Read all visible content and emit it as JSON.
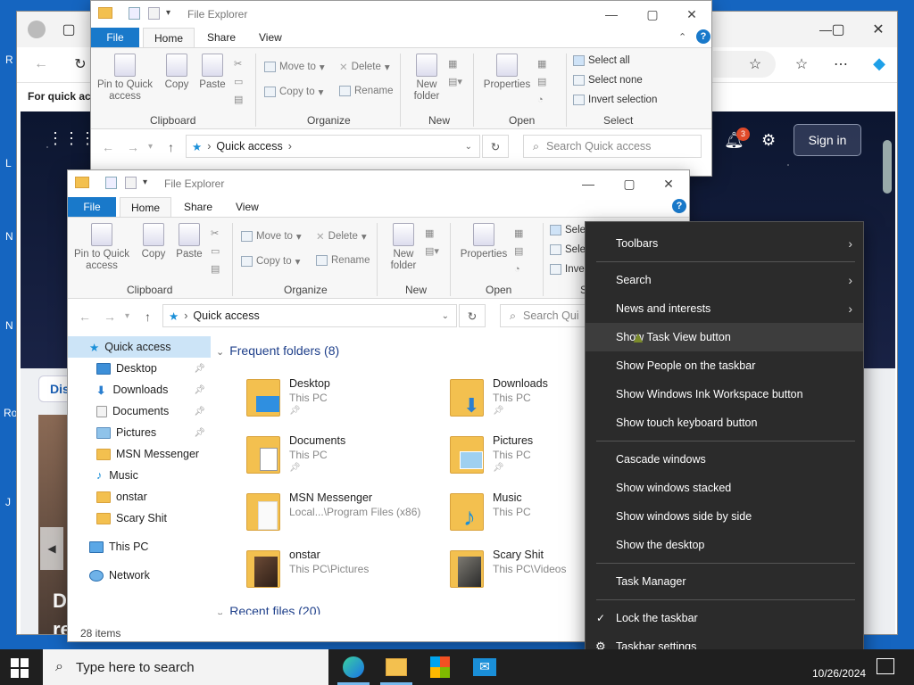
{
  "browser": {
    "address_partial": "For quick acc",
    "sign_in": "Sign in",
    "badge": "3",
    "card_label": "Dis",
    "card_big1": "D",
    "card_big2": "re",
    "card_row_label": "Ro"
  },
  "explorer_back": {
    "title": "File Explorer",
    "tabs": [
      "File",
      "Home",
      "Share",
      "View"
    ],
    "ribbon": {
      "pin": "Pin to Quick access",
      "copy": "Copy",
      "paste": "Paste",
      "move_to": "Move to",
      "copy_to": "Copy to",
      "delete": "Delete",
      "rename": "Rename",
      "new_folder": "New folder",
      "properties": "Properties",
      "select_all": "Select all",
      "select_none": "Select none",
      "invert_selection": "Invert selection",
      "groups": [
        "Clipboard",
        "Organize",
        "New",
        "Open",
        "Select"
      ]
    },
    "breadcrumb": "Quick access",
    "search_placeholder": "Search Quick access"
  },
  "explorer_front": {
    "title": "File Explorer",
    "tabs": [
      "File",
      "Home",
      "Share",
      "View"
    ],
    "ribbon": {
      "pin": "Pin to Quick access",
      "copy": "Copy",
      "paste": "Paste",
      "move_to": "Move to",
      "copy_to": "Copy to",
      "delete": "Delete",
      "rename": "Rename",
      "new_folder": "New folder",
      "properties": "Properties",
      "select_partial": "Sele",
      "invert_partial": "Inve",
      "groups": [
        "Clipboard",
        "Organize",
        "New",
        "Open",
        "S"
      ]
    },
    "breadcrumb": "Quick access",
    "search_placeholder": "Search Qui",
    "sidebar": [
      {
        "label": "Quick access",
        "pinned": false
      },
      {
        "label": "Desktop",
        "pinned": true
      },
      {
        "label": "Downloads",
        "pinned": true
      },
      {
        "label": "Documents",
        "pinned": true
      },
      {
        "label": "Pictures",
        "pinned": true
      },
      {
        "label": "MSN Messenger",
        "pinned": false
      },
      {
        "label": "Music",
        "pinned": false
      },
      {
        "label": "onstar",
        "pinned": false
      },
      {
        "label": "Scary Shit",
        "pinned": false
      },
      {
        "label": "This PC",
        "pinned": false
      },
      {
        "label": "Network",
        "pinned": false
      }
    ],
    "section_title": "Frequent folders (8)",
    "recent_title": "Recent files (20)",
    "folders": [
      {
        "name": "Desktop",
        "loc": "This PC",
        "pinned": true
      },
      {
        "name": "Downloads",
        "loc": "This PC",
        "pinned": true
      },
      {
        "name": "Documents",
        "loc": "This PC",
        "pinned": true
      },
      {
        "name": "Pictures",
        "loc": "This PC",
        "pinned": true
      },
      {
        "name": "MSN Messenger",
        "loc": "Local...\\Program Files (x86)",
        "pinned": false
      },
      {
        "name": "Music",
        "loc": "This PC",
        "pinned": false
      },
      {
        "name": "onstar",
        "loc": "This PC\\Pictures",
        "pinned": false
      },
      {
        "name": "Scary Shit",
        "loc": "This PC\\Videos",
        "pinned": false
      }
    ],
    "status": "28 items"
  },
  "context_menu": {
    "items": [
      "Toolbars",
      "Search",
      "News and interests",
      "Show Task View button",
      "Show People on the taskbar",
      "Show Windows Ink Workspace button",
      "Show touch keyboard button",
      "Cascade windows",
      "Show windows stacked",
      "Show windows side by side",
      "Show the desktop",
      "Task Manager",
      "Lock the taskbar",
      "Taskbar settings"
    ]
  },
  "taskbar": {
    "search_placeholder": "Type here to search",
    "date": "10/26/2024"
  },
  "desktop_labels": [
    "R",
    "L",
    "N",
    "N",
    "Ro",
    "J"
  ]
}
